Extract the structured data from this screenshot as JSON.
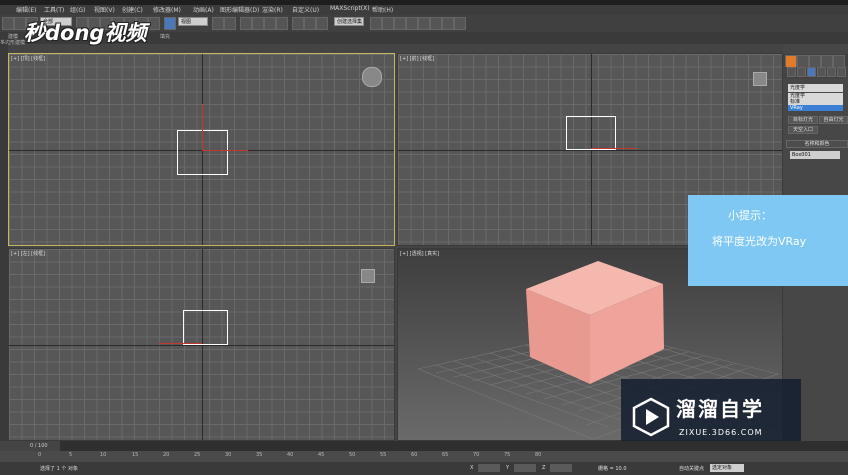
{
  "menu": {
    "items": [
      "编辑(E)",
      "工具(T)",
      "组(G)",
      "视图(V)",
      "创建(C)",
      "修改器(M)",
      "动画(A)",
      "图形编辑器(D)",
      "渲染(R)",
      "自定义(U)",
      "MAXScript(X)",
      "帮助(H)"
    ]
  },
  "toolbar": {
    "filter_select": "全部",
    "refcoord_select": "视图",
    "selset_select": "创建选择集"
  },
  "ribbon": {
    "left_tab": "建模",
    "mid_tab": "填充",
    "sub_label": "多边形建模"
  },
  "watermark": {
    "text": "秒dong视频"
  },
  "viewports": {
    "top_label": "[+] [顶] [线框]",
    "front_label": "[+] [前] [线框]",
    "left_label": "[+] [左] [线框]",
    "persp_label": "[+] [透视] [真实]"
  },
  "command_panel": {
    "dropdown_value": "光度学",
    "options": [
      "光度学",
      "标准",
      "VRay"
    ],
    "selected_option": "VRay",
    "btn_target_light": "目标灯光",
    "btn_free_light": "自由灯光",
    "btn_skylight": "天空入口",
    "rollout_name_color": "名称和颜色",
    "object_name": "Box001"
  },
  "tip": {
    "title": "小提示：",
    "text": "将平度光改为VRay"
  },
  "logo": {
    "main": "溜溜自学",
    "url": "ZIXUE.3D66.COM"
  },
  "timeline": {
    "frame_counter": "0 / 100",
    "ticks": [
      "0",
      "5",
      "10",
      "15",
      "20",
      "25",
      "30",
      "35",
      "40",
      "45",
      "50",
      "55",
      "60",
      "65",
      "70",
      "75",
      "80"
    ]
  },
  "status": {
    "selection": "选择了 1 个 对象",
    "grid": "栅格 = 10.0",
    "autokey": "自动关键点",
    "selected_dd": "选定对象",
    "coord_x": "X",
    "coord_y": "Y",
    "coord_z": "Z"
  },
  "colors": {
    "accent": "#7ec8f3",
    "cube": "#f0a9a0",
    "selected_border": "#c8b560"
  }
}
